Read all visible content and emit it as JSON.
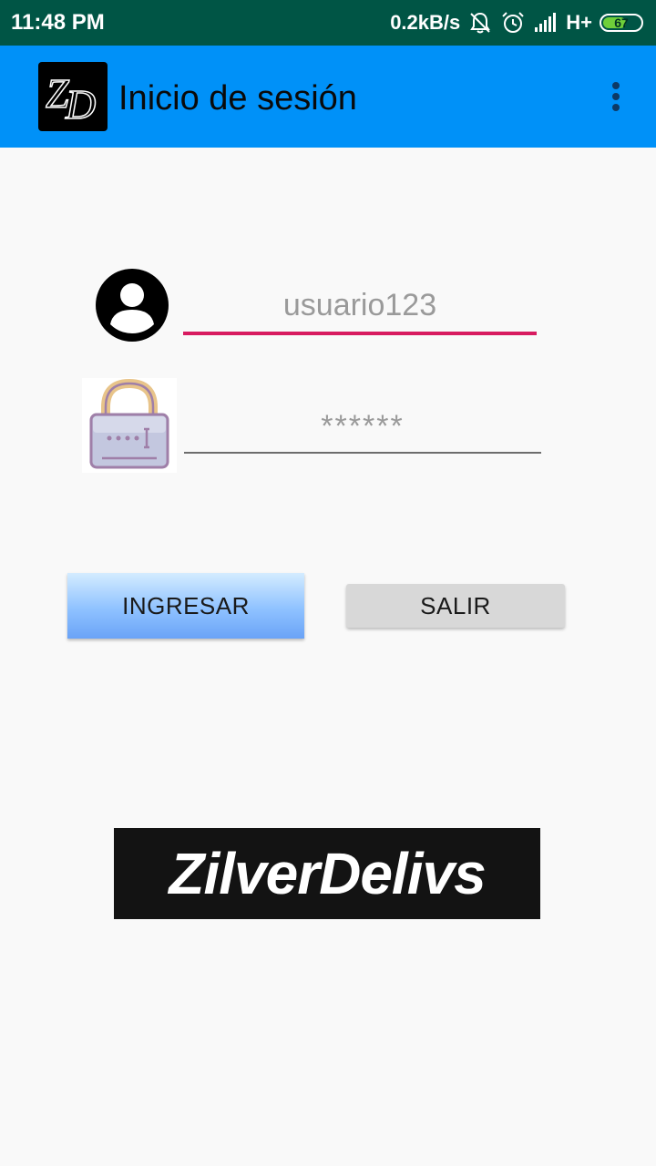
{
  "status_bar": {
    "time": "11:48 PM",
    "net_speed": "0.2kB/s",
    "network_type": "H+",
    "battery_percent": "67",
    "battery_level": 0.67,
    "icons": [
      "mute-icon",
      "alarm-icon",
      "signal-icon",
      "battery-icon"
    ]
  },
  "app_bar": {
    "title": "Inicio de sesión",
    "logo_text": "ZD",
    "menu_icon": "overflow-menu-icon",
    "color": "#0091f8"
  },
  "form": {
    "username_placeholder": "usuario123",
    "username_value": "",
    "password_placeholder": "******",
    "password_value": "",
    "user_icon": "user-avatar-icon",
    "password_icon": "lock-icon",
    "focus_color": "#d81b60"
  },
  "buttons": {
    "login_label": "INGRESAR",
    "exit_label": "SALIR"
  },
  "brand": {
    "name": "ZilverDelivs"
  }
}
